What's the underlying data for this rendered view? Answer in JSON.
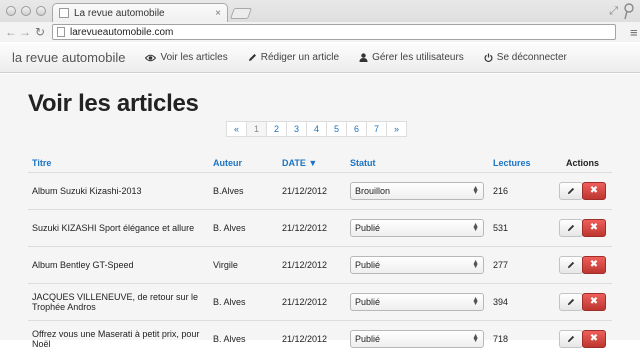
{
  "browser": {
    "tab_title": "La revue automobile",
    "tab_close": "×",
    "url": "larevueautomobile.com",
    "back": "←",
    "forward": "→",
    "reload": "C"
  },
  "navbar": {
    "brand": "la revue automobile",
    "links": [
      {
        "label": "Voir les articles",
        "icon": "eye-icon"
      },
      {
        "label": "Rédiger un article",
        "icon": "pencil-icon"
      },
      {
        "label": "Gérer les utilisateurs",
        "icon": "user-icon"
      },
      {
        "label": "Se déconnecter",
        "icon": "power-icon"
      }
    ]
  },
  "page": {
    "title": "Voir les articles"
  },
  "pagination": {
    "prev": "«",
    "pages": [
      "1",
      "2",
      "3",
      "4",
      "5",
      "6",
      "7"
    ],
    "next": "»",
    "active": "1"
  },
  "table": {
    "headers": {
      "titre": "Titre",
      "auteur": "Auteur",
      "date": "DATE ▼",
      "statut": "Statut",
      "lectures": "Lectures",
      "actions": "Actions"
    },
    "rows": [
      {
        "titre": "Album Suzuki Kizashi-2013",
        "auteur": "B.Alves",
        "date": "21/12/2012",
        "statut": "Brouillon",
        "lectures": "216"
      },
      {
        "titre": "Suzuki KIZASHI Sport élégance et allure",
        "auteur": "B. Alves",
        "date": "21/12/2012",
        "statut": "Publié",
        "lectures": "531"
      },
      {
        "titre": "Album Bentley GT-Speed",
        "auteur": "Virgile",
        "date": "21/12/2012",
        "statut": "Publié",
        "lectures": "277"
      },
      {
        "titre": "JACQUES VILLENEUVE, de retour sur le Trophée Andros",
        "auteur": "B. Alves",
        "date": "21/12/2012",
        "statut": "Publié",
        "lectures": "394"
      },
      {
        "titre": "Offrez vous une Maserati à petit prix, pour Noël",
        "auteur": "B. Alves",
        "date": "21/12/2012",
        "statut": "Publié",
        "lectures": "718"
      }
    ]
  },
  "colors": {
    "link": "#1c74c4",
    "danger": "#da4f49",
    "background": "#f5f5f5"
  }
}
